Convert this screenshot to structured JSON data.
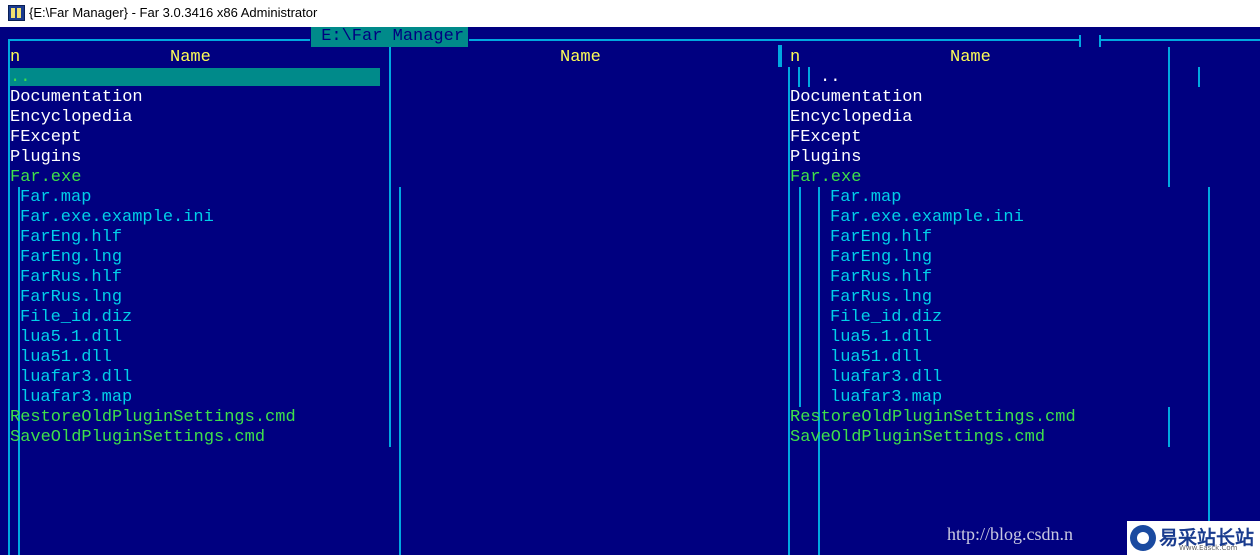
{
  "window": {
    "title": "{E:\\Far Manager} - Far 3.0.3416 x86 Administrator",
    "icon": "far-manager-icon"
  },
  "left_panel": {
    "path_title": " E:\\Far Manager ",
    "col_n_header": "n",
    "col1_header": "Name",
    "col2_header": "Name",
    "selected_item": "..",
    "files": [
      {
        "name": "Documentation",
        "kind": "folder"
      },
      {
        "name": "Encyclopedia",
        "kind": "folder"
      },
      {
        "name": "FExcept",
        "kind": "folder"
      },
      {
        "name": "Plugins",
        "kind": "folder"
      },
      {
        "name": "Far.exe",
        "kind": "executable"
      },
      {
        "name": "Far.map",
        "kind": "file"
      },
      {
        "name": "Far.exe.example.ini",
        "kind": "file"
      },
      {
        "name": "FarEng.hlf",
        "kind": "file"
      },
      {
        "name": "FarEng.lng",
        "kind": "file"
      },
      {
        "name": "FarRus.hlf",
        "kind": "file"
      },
      {
        "name": "FarRus.lng",
        "kind": "file"
      },
      {
        "name": "File_id.diz",
        "kind": "file"
      },
      {
        "name": "lua5.1.dll",
        "kind": "file"
      },
      {
        "name": "lua51.dll",
        "kind": "file"
      },
      {
        "name": "luafar3.dll",
        "kind": "file"
      },
      {
        "name": "luafar3.map",
        "kind": "file"
      },
      {
        "name": "RestoreOldPluginSettings.cmd",
        "kind": "executable"
      },
      {
        "name": "SaveOldPluginSettings.cmd",
        "kind": "executable"
      }
    ]
  },
  "right_panel": {
    "col_n_header": "n",
    "col1_header": "Name",
    "parent_item": "..",
    "files": [
      {
        "name": "Documentation",
        "kind": "folder"
      },
      {
        "name": "Encyclopedia",
        "kind": "folder"
      },
      {
        "name": "FExcept",
        "kind": "folder"
      },
      {
        "name": "Plugins",
        "kind": "folder"
      },
      {
        "name": "Far.exe",
        "kind": "executable"
      },
      {
        "name": "Far.map",
        "kind": "file"
      },
      {
        "name": "Far.exe.example.ini",
        "kind": "file"
      },
      {
        "name": "FarEng.hlf",
        "kind": "file"
      },
      {
        "name": "FarEng.lng",
        "kind": "file"
      },
      {
        "name": "FarRus.hlf",
        "kind": "file"
      },
      {
        "name": "FarRus.lng",
        "kind": "file"
      },
      {
        "name": "File_id.diz",
        "kind": "file"
      },
      {
        "name": "lua5.1.dll",
        "kind": "file"
      },
      {
        "name": "lua51.dll",
        "kind": "file"
      },
      {
        "name": "luafar3.dll",
        "kind": "file"
      },
      {
        "name": "luafar3.map",
        "kind": "file"
      },
      {
        "name": "RestoreOldPluginSettings.cmd",
        "kind": "executable"
      },
      {
        "name": "SaveOldPluginSettings.cmd",
        "kind": "executable"
      }
    ]
  },
  "watermark": {
    "url_text": "http://blog.csdn.n",
    "logo_text": "易采站长站",
    "logo_sub": "Www.Easck.Com"
  },
  "colors": {
    "console_bg": "#000080",
    "frame": "#00a8e0",
    "header_text": "#ffff55",
    "folder_text": "#ffffff",
    "file_text": "#00cfe8",
    "exec_text": "#3ee04a",
    "selection_bg": "#008a8a"
  }
}
